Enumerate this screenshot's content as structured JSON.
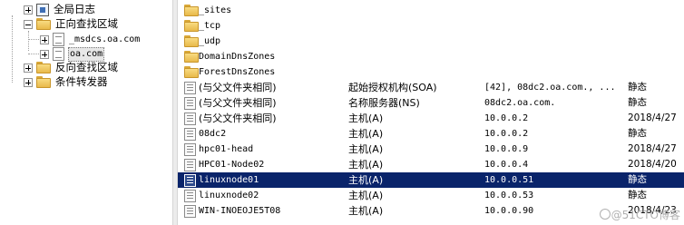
{
  "tree": {
    "items": [
      {
        "label": "全局日志",
        "icon": "log-icon",
        "expander": "plus"
      },
      {
        "label": "正向查找区域",
        "icon": "folder-icon",
        "expander": "minus"
      },
      {
        "label": "_msdcs.oa.com",
        "icon": "zone-file-icon",
        "expander": "plus"
      },
      {
        "label": "oa.com",
        "icon": "zone-file-icon",
        "expander": "plus",
        "selected": true
      },
      {
        "label": "反向查找区域",
        "icon": "folder-icon",
        "expander": "plus"
      },
      {
        "label": "条件转发器",
        "icon": "folder-icon",
        "expander": "plus"
      }
    ]
  },
  "list": {
    "folders": [
      "_sites",
      "_tcp",
      "_udp",
      "DomainDnsZones",
      "ForestDnsZones"
    ],
    "records": [
      {
        "name": "(与父文件夹相同)",
        "type": "起始授权机构(SOA)",
        "data": "[42], 08dc2.oa.com., ...",
        "timestamp": "静态"
      },
      {
        "name": "(与父文件夹相同)",
        "type": "名称服务器(NS)",
        "data": "08dc2.oa.com.",
        "timestamp": "静态"
      },
      {
        "name": "(与父文件夹相同)",
        "type": "主机(A)",
        "data": "10.0.0.2",
        "timestamp": "2018/4/27"
      },
      {
        "name": "08dc2",
        "type": "主机(A)",
        "data": "10.0.0.2",
        "timestamp": "静态"
      },
      {
        "name": "hpc01-head",
        "type": "主机(A)",
        "data": "10.0.0.9",
        "timestamp": "2018/4/27"
      },
      {
        "name": "HPC01-Node02",
        "type": "主机(A)",
        "data": "10.0.0.4",
        "timestamp": "2018/4/20"
      },
      {
        "name": "linuxnode01",
        "type": "主机(A)",
        "data": "10.0.0.51",
        "timestamp": "静态",
        "selected": true
      },
      {
        "name": "linuxnode02",
        "type": "主机(A)",
        "data": "10.0.0.53",
        "timestamp": "静态"
      },
      {
        "name": "WIN-INOEOJE5T08",
        "type": "主机(A)",
        "data": "10.0.0.90",
        "timestamp": "2018/4/23"
      }
    ]
  },
  "watermark": "@51CTO博客",
  "colors": {
    "selection": "#0a246a",
    "folder": "#f3cc63"
  }
}
